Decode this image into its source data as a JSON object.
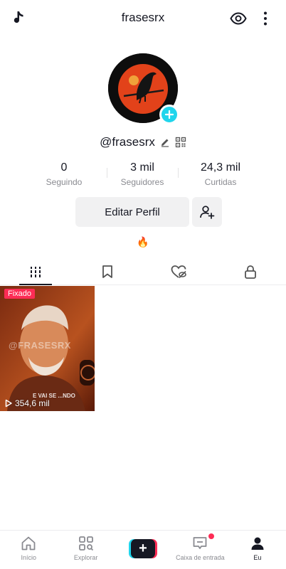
{
  "header": {
    "title": "frasesrx",
    "left_icon": "tiktok-note-icon",
    "eye_icon": "eye-icon",
    "more_icon": "more-vertical-icon"
  },
  "profile": {
    "username": "@frasesrx",
    "edit_icon": "pencil-icon",
    "qr_icon": "qr-code-icon",
    "bio": "🔥"
  },
  "stats": [
    {
      "value": "0",
      "label": "Seguindo"
    },
    {
      "value": "3 mil",
      "label": "Seguidores"
    },
    {
      "value": "24,3 mil",
      "label": "Curtidas"
    }
  ],
  "actions": {
    "edit_label": "Editar Perfil",
    "add_friend_icon": "add-friend-icon"
  },
  "tabs": [
    {
      "icon": "grid-videos-icon",
      "active": true
    },
    {
      "icon": "bookmark-icon",
      "active": false
    },
    {
      "icon": "liked-hidden-icon",
      "active": false
    },
    {
      "icon": "lock-icon",
      "active": false
    }
  ],
  "videos": [
    {
      "pinned_label": "Fixado",
      "views": "354,6 mil",
      "watermark": "@FRASESRX",
      "caption": "E VAI SE ...NDO"
    }
  ],
  "bottom_nav": [
    {
      "label": "Início",
      "icon": "home-icon",
      "active": false
    },
    {
      "label": "Explorar",
      "icon": "explore-icon",
      "active": false
    },
    {
      "label": "",
      "icon": "create-plus-icon",
      "active": false
    },
    {
      "label": "Caixa de entrada",
      "icon": "inbox-icon",
      "active": false,
      "notification_dot": true
    },
    {
      "label": "Eu",
      "icon": "profile-icon",
      "active": true
    }
  ],
  "colors": {
    "accent_red": "#fe2c55",
    "accent_cyan": "#20d5ec",
    "text_primary": "#161823",
    "text_secondary": "#8a8b91",
    "button_bg": "#f1f1f2"
  }
}
